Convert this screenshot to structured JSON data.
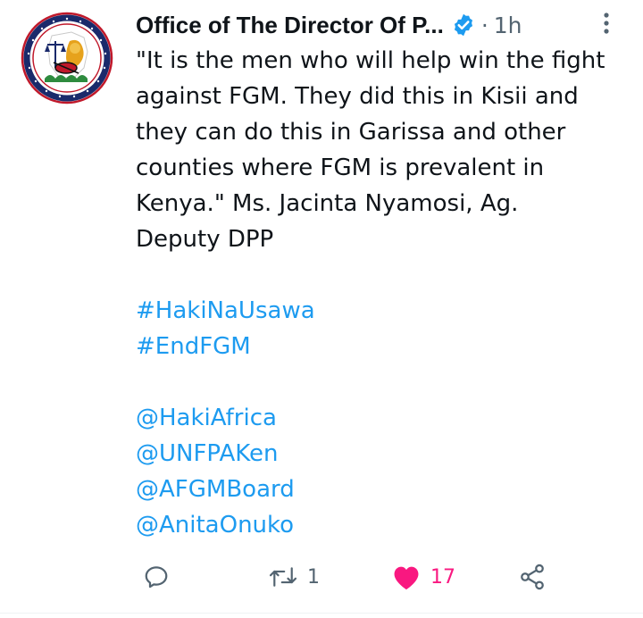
{
  "tweet": {
    "author_name": "Office of The Director Of P...",
    "dot": "·",
    "time": "1h",
    "avatar_icon": "odpp-kenya-seal-logo",
    "verified_icon": "verified-badge-icon",
    "text_lines": [
      "\"It is the men who will help win the fight",
      "against FGM. They did this in Kisii and",
      "they can do this in Garissa and other",
      "counties where FGM is prevalent in",
      "Kenya.\" Ms. Jacinta Nyamosi, Ag.",
      "Deputy DPP"
    ],
    "hashtags": [
      "#HakiNaUsawa",
      "#EndFGM"
    ],
    "mentions": [
      "@HakiAfrica",
      "@UNFPAKen",
      "@AFGMBoard",
      "@AnitaOnuko"
    ],
    "actions": {
      "reply_icon": "reply-icon",
      "retweet_icon": "retweet-icon",
      "retweet_count": "1",
      "like_icon": "heart-icon",
      "like_count": "17",
      "like_color": "#f91880",
      "share_icon": "share-icon"
    },
    "colors": {
      "link": "#1d9bf0",
      "text": "#0f1419",
      "muted": "#536471",
      "verified": "#1d9bf0"
    }
  }
}
